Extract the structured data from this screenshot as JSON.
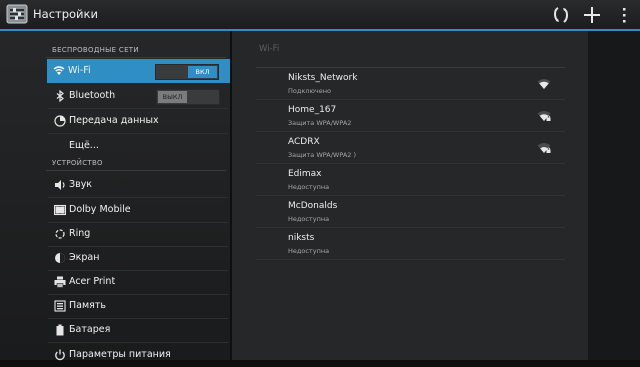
{
  "actionbar": {
    "title": "Настройки",
    "icons": [
      "settings-app-icon",
      "sync-icon",
      "add-icon",
      "overflow-menu-icon"
    ]
  },
  "sidebar": {
    "sections": [
      {
        "header": "БЕСПРОВОДНЫЕ СЕТИ"
      },
      {
        "header": "УСТРОЙСТВО"
      }
    ],
    "items": [
      {
        "label": "Wi-Fi",
        "icon": "wifi-icon",
        "toggle": "ВКЛ",
        "selected": true
      },
      {
        "label": "Bluetooth",
        "icon": "bluetooth-icon",
        "toggle": "ВЫКЛ"
      },
      {
        "label": "Передача данных",
        "icon": "data-usage-icon"
      },
      {
        "label": "Ещё...",
        "icon": ""
      },
      {
        "label": "Звук",
        "icon": "speaker-icon"
      },
      {
        "label": "Dolby Mobile",
        "icon": "dolby-icon"
      },
      {
        "label": "Ring",
        "icon": "ring-icon"
      },
      {
        "label": "Экран",
        "icon": "display-icon"
      },
      {
        "label": "Acer Print",
        "icon": "printer-icon"
      },
      {
        "label": "Память",
        "icon": "storage-icon"
      },
      {
        "label": "Батарея",
        "icon": "battery-icon"
      },
      {
        "label": "Параметры питания",
        "icon": "power-icon"
      }
    ]
  },
  "wifi": {
    "title": "Wi-Fi",
    "networks": [
      {
        "name": "Niksts_Network",
        "status": "Подключено",
        "signal": "wifi-signal-icon"
      },
      {
        "name": "Home_167",
        "status": "Защита WPA/WPA2",
        "signal": "wifi-locked-icon"
      },
      {
        "name": "ACDRX",
        "status": "Защита WPA/WPA2 )",
        "signal": "wifi-locked-icon"
      },
      {
        "name": "Edimax",
        "status": "Недоступна"
      },
      {
        "name": "McDonalds",
        "status": "Недоступна"
      },
      {
        "name": "niksts",
        "status": "Недоступна"
      }
    ]
  },
  "colors": {
    "accent": "#2f8fc4",
    "background": "#0f0f10",
    "pane": "#262728"
  }
}
